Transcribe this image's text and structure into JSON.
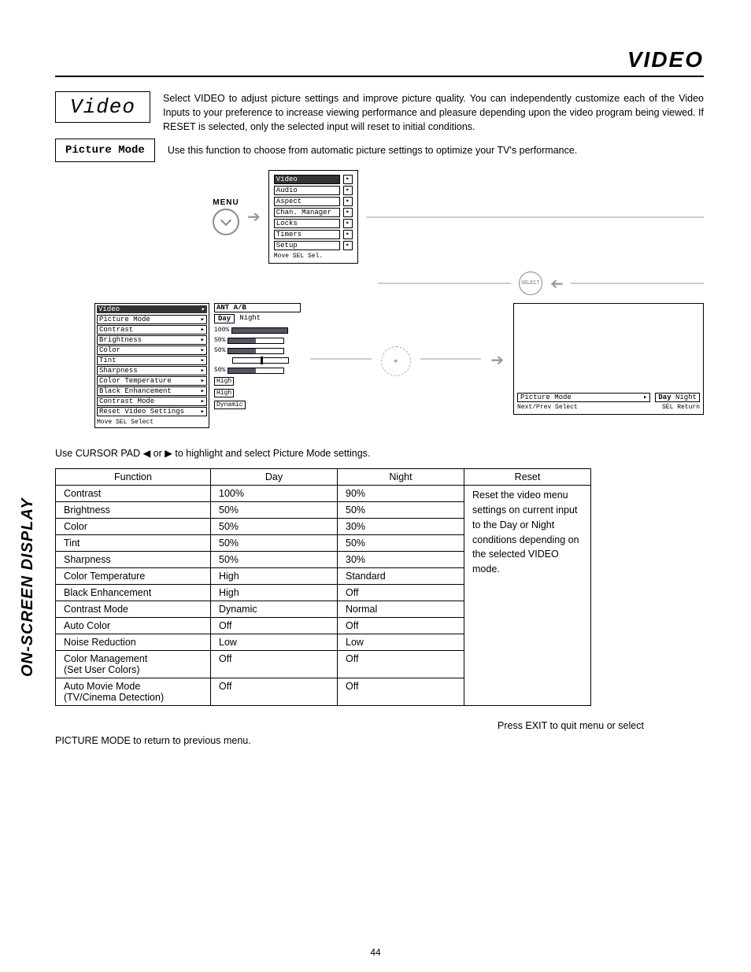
{
  "page_title": "VIDEO",
  "side_label": "ON-SCREEN DISPLAY",
  "page_number": "44",
  "video_box_label": "Video",
  "intro_text": "Select VIDEO to adjust picture settings and improve picture quality.  You can independently customize each of the Video Inputs to your preference to increase viewing performance and pleasure depending upon the video program being viewed.  If RESET is selected, only the selected input will reset to initial conditions.",
  "picture_mode_box": "Picture Mode",
  "picture_mode_desc": "Use this function to choose from automatic picture settings to optimize your TV's performance.",
  "menu_label": "MENU",
  "select_btn": "SELECT",
  "main_menu": {
    "items": [
      "Video",
      "Audio",
      "Aspect",
      "Chan. Manager",
      "Locks",
      "Timers",
      "Setup"
    ],
    "footer": "Move SEL Sel."
  },
  "video_menu": {
    "header": "Video",
    "items": [
      "Picture Mode",
      "Contrast",
      "Brightness",
      "Color",
      "Tint",
      "Sharpness",
      "Color Temperature",
      "Black Enhancement",
      "Contrast Mode",
      "Reset Video Settings"
    ],
    "footer": "Move SEL Select"
  },
  "video_values_panel": {
    "header": "ANT A/B",
    "mode_row": {
      "day": "Day",
      "night": "Night"
    },
    "rows": [
      {
        "pct": "100%",
        "fill": 100
      },
      {
        "pct": "50%",
        "fill": 50
      },
      {
        "pct": "50%",
        "fill": 50
      },
      {
        "pct": "",
        "marker": 50
      },
      {
        "pct": "50%",
        "fill": 50
      },
      {
        "text": "High"
      },
      {
        "text": "High"
      },
      {
        "text": "Dynamic"
      }
    ]
  },
  "right_osd": {
    "label": "Picture Mode",
    "day": "Day",
    "night": "Night",
    "footer_left": "Next/Prev    Select",
    "footer_right": "SEL Return"
  },
  "cursor_instruction": "Use CURSOR PAD ◀ or ▶ to highlight and select Picture Mode settings.",
  "table": {
    "headers": [
      "Function",
      "Day",
      "Night",
      "Reset"
    ],
    "rows": [
      {
        "f": "Contrast",
        "d": "100%",
        "n": "90%"
      },
      {
        "f": "Brightness",
        "d": "50%",
        "n": "50%"
      },
      {
        "f": "Color",
        "d": "50%",
        "n": "30%"
      },
      {
        "f": "Tint",
        "d": "50%",
        "n": "50%"
      },
      {
        "f": "Sharpness",
        "d": "50%",
        "n": "30%"
      },
      {
        "f": "Color Temperature",
        "d": "High",
        "n": "Standard"
      },
      {
        "f": "Black Enhancement",
        "d": "High",
        "n": "Off"
      },
      {
        "f": "Contrast Mode",
        "d": "Dynamic",
        "n": "Normal"
      },
      {
        "f": "Auto Color",
        "d": "Off",
        "n": "Off"
      },
      {
        "f": "Noise Reduction",
        "d": "Low",
        "n": "Low"
      },
      {
        "f": "Color Management\n(Set User Colors)",
        "d": "Off",
        "n": "Off"
      },
      {
        "f": "Auto Movie Mode\n(TV/Cinema Detection)",
        "d": "Off",
        "n": "Off"
      }
    ],
    "reset_text": "Reset the video menu settings on current input to the Day or Night conditions depending on the selected VIDEO mode."
  },
  "exit_text_right": "Press EXIT to quit menu or select",
  "exit_text_left": "PICTURE MODE to return to previous menu."
}
